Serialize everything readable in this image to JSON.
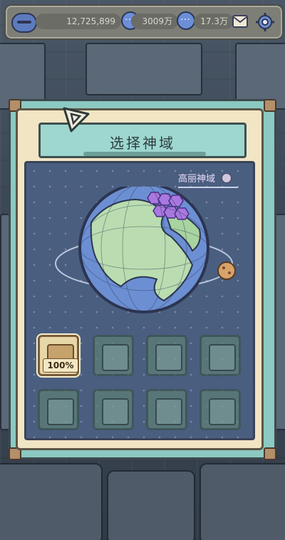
{
  "topbar": {
    "coins": "12,725,899",
    "stat_a": "3009万",
    "stat_b": "17.3万"
  },
  "panel": {
    "title": "选择神域",
    "region_label": "高丽神域"
  },
  "slots": [
    {
      "name": "cuisine",
      "progress": "100%",
      "active": true
    },
    {
      "name": "mountain",
      "active": false
    },
    {
      "name": "castle",
      "active": false
    },
    {
      "name": "bridge",
      "active": false
    },
    {
      "name": "church",
      "active": false
    },
    {
      "name": "peak",
      "active": false
    },
    {
      "name": "dome",
      "active": false
    },
    {
      "name": "palace",
      "active": false
    }
  ],
  "colors": {
    "panel_frame": "#8cc9c2",
    "panel_inner": "#f1e5c4",
    "board": "#4a5e80",
    "highlight_region": "#a878e0"
  },
  "icons": [
    "avatar-icon",
    "chat-bubble-icon",
    "mail-icon",
    "gear-icon",
    "globe-icon",
    "planet-icon"
  ]
}
